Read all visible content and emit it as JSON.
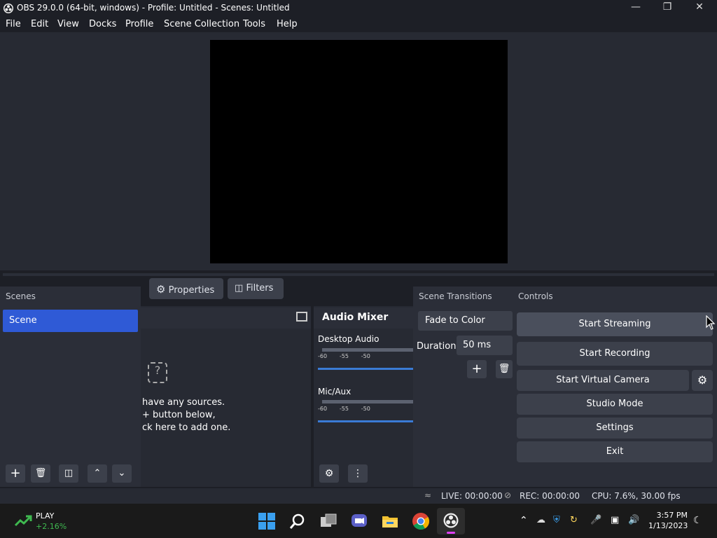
{
  "window": {
    "title": "OBS 29.0.0 (64-bit, windows) - Profile: Untitled - Scenes: Untitled"
  },
  "menu": [
    "File",
    "Edit",
    "View",
    "Docks",
    "Profile",
    "Scene Collection",
    "Tools",
    "Help"
  ],
  "toolbar": {
    "properties": "Properties",
    "filters": "Filters"
  },
  "scenes": {
    "header": "Scenes",
    "items": [
      "Scene"
    ]
  },
  "sources": {
    "empty_lines": [
      "have any sources.",
      "+ button below,",
      "ck here to add one."
    ]
  },
  "audio": {
    "header": "Audio Mixer",
    "channels": [
      {
        "name": "Desktop Audio",
        "ticks": [
          "-60",
          "-55",
          "-50"
        ],
        "volume": 1.0
      },
      {
        "name": "Mic/Aux",
        "ticks": [
          "-60",
          "-55",
          "-50"
        ],
        "volume": 1.0
      }
    ]
  },
  "transitions": {
    "header": "Scene Transitions",
    "selected": "Fade to Color",
    "duration_label": "Duration",
    "duration_value": "50 ms"
  },
  "controls": {
    "header": "Controls",
    "start_streaming": "Start Streaming",
    "start_recording": "Start Recording",
    "start_virtual_camera": "Start Virtual Camera",
    "studio_mode": "Studio Mode",
    "settings": "Settings",
    "exit": "Exit"
  },
  "status": {
    "live": "LIVE: 00:00:00",
    "rec": "REC: 00:00:00",
    "cpu": "CPU: 7.6%, 30.00 fps"
  },
  "taskbar": {
    "stock_name": "PLAY",
    "stock_change": "+2.16%",
    "time": "3:57 PM",
    "date": "1/13/2023"
  },
  "colors": {
    "accent": "#2f5ad6",
    "window_bg": "#1d1f26",
    "panel": "#2b2e38",
    "button": "#3c404b",
    "stock_up": "#3fb950"
  }
}
